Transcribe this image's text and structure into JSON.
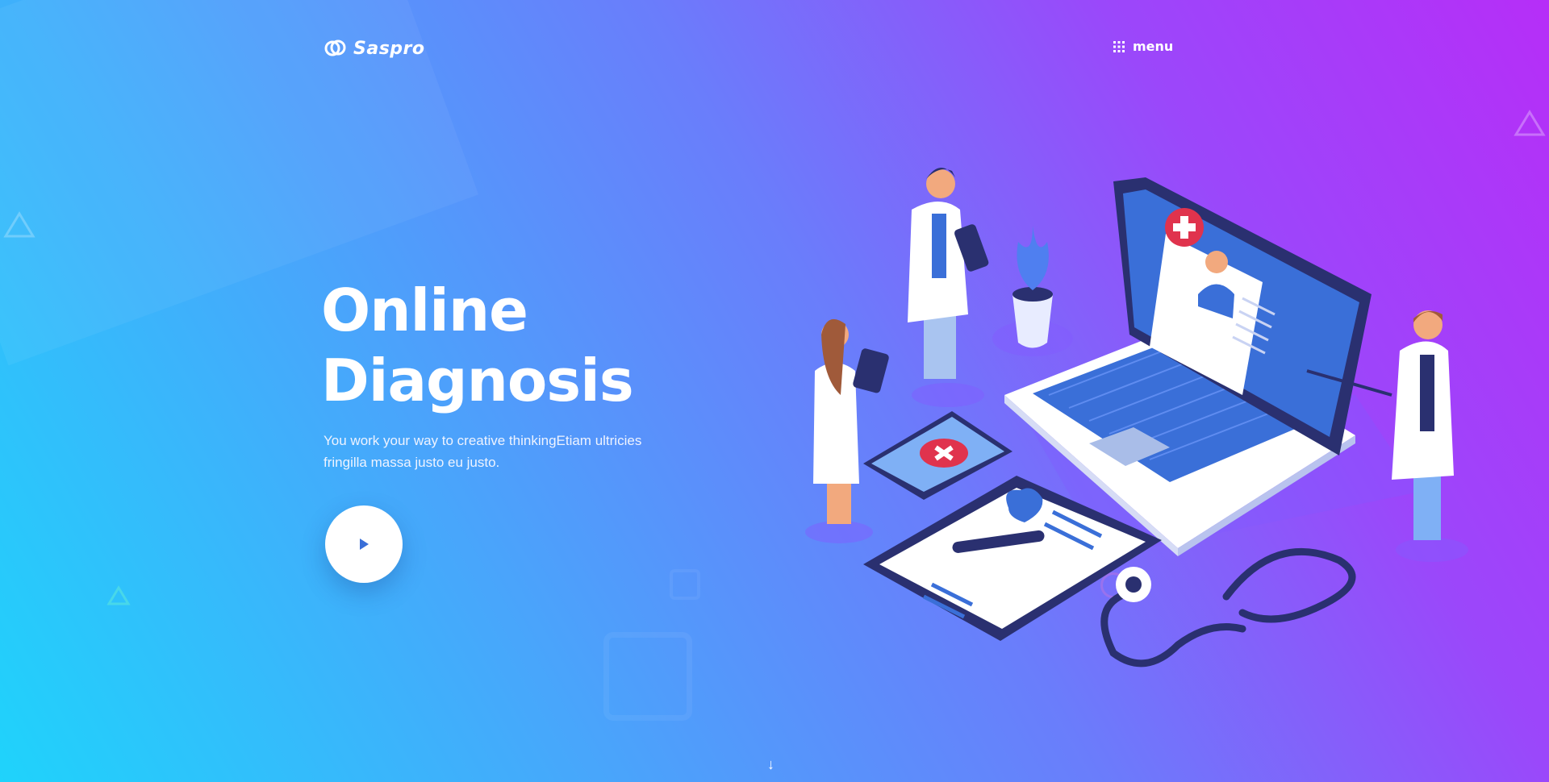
{
  "brand": {
    "name": "Saspro",
    "logo_icon": "double-ring-logo"
  },
  "nav": {
    "menu_label": "menu",
    "menu_icon": "grid-dots-icon"
  },
  "hero": {
    "title_line1": "Online",
    "title_line2": "Diagnosis",
    "description": "You work your way to creative thinkingEtiam ultricies fringilla massa justo eu justo.",
    "play_icon": "play-icon"
  },
  "scroll": {
    "icon": "arrow-down-icon",
    "glyph": "↓"
  },
  "colors": {
    "gradient_start": "#1fd3fb",
    "gradient_end": "#b62ef8",
    "accent_blue": "#3a6fd8",
    "accent_red": "#e0334d",
    "navy": "#2a3070"
  }
}
